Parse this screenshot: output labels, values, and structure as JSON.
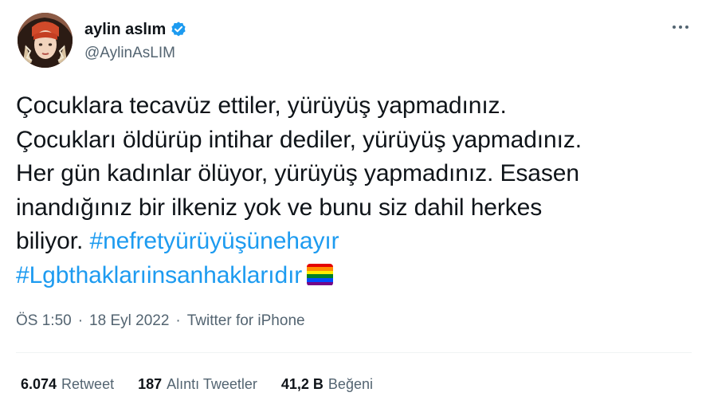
{
  "user": {
    "display_name": "aylin aslım",
    "handle": "@AylinAsLIM"
  },
  "tweet": {
    "lines": [
      "Çocuklara tecavüz ettiler, yürüyüş yapmadınız.",
      "Çocukları öldürüp intihar dediler, yürüyüş yapmadınız.",
      "Her gün kadınlar ölüyor, yürüyüş yapmadınız. Esasen",
      "inandığınız bir ilkeniz yok ve bunu siz dahil herkes",
      "biliyor."
    ],
    "hashtag_1": "#nefretyürüyüşünehayır",
    "hashtag_2": "#Lgbthaklarıinsanhaklarıdır",
    "emoji": "rainbow-flag-icon"
  },
  "meta": {
    "time": "ÖS 1:50",
    "date": "18 Eyl 2022",
    "separator": "·",
    "source": "Twitter for iPhone"
  },
  "stats": {
    "retweets_count": "6.074",
    "retweets_label": "Retweet",
    "quotes_count": "187",
    "quotes_label": "Alıntı Tweetler",
    "likes_count": "41,2 B",
    "likes_label": "Beğeni"
  },
  "colors": {
    "link": "#1d9bf0",
    "secondary_text": "#536471",
    "primary_text": "#0f1419",
    "verified": "#1d9bf0"
  }
}
